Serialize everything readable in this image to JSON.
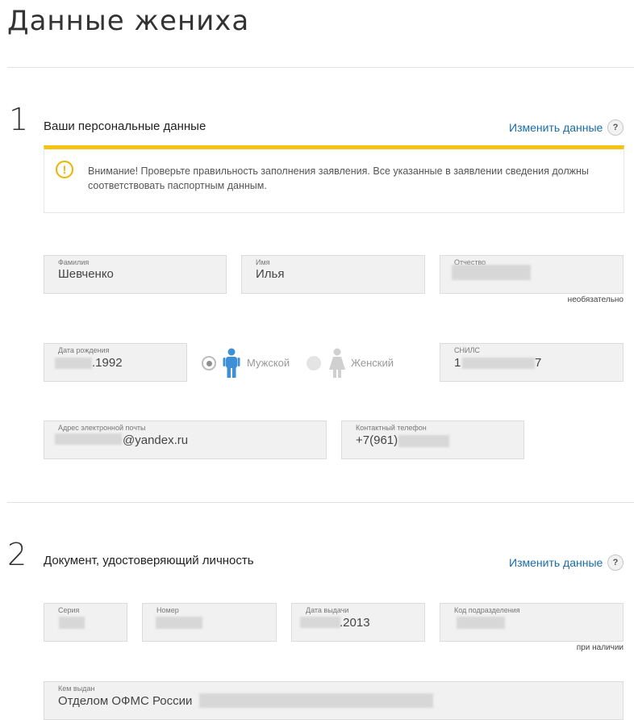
{
  "page": {
    "title": "Данные жениха"
  },
  "section1": {
    "number": "1",
    "title": "Ваши персональные данные",
    "edit_link": "Изменить данные",
    "help_label": "?",
    "warning": {
      "icon": "exclamation-circle-icon",
      "text": "Внимание! Проверьте правильность заполнения заявления. Все указанные в заявлении сведения должны соответствовать паспортным данным."
    },
    "fields": {
      "surname": {
        "label": "Фамилия",
        "value": "Шевченко"
      },
      "name": {
        "label": "Имя",
        "value": "Илья"
      },
      "patronymic": {
        "label": "Отчество",
        "value": "",
        "note": "необязательно"
      },
      "birthdate": {
        "label": "Дата рождения",
        "value": ".1992"
      },
      "snils": {
        "label": "СНИЛС",
        "value_start": "1",
        "value_end": "7"
      },
      "email": {
        "label": "Адрес электронной почты",
        "value": "@yandex.ru"
      },
      "phone": {
        "label": "Контактный телефон",
        "value": "+7(961)"
      }
    },
    "gender": {
      "male_label": "Мужской",
      "female_label": "Женский",
      "selected": "male"
    }
  },
  "section2": {
    "number": "2",
    "title": "Документ, удостоверяющий личность",
    "edit_link": "Изменить данные",
    "help_label": "?",
    "fields": {
      "series": {
        "label": "Серия",
        "value": ""
      },
      "number": {
        "label": "Номер",
        "value": ""
      },
      "issue_date": {
        "label": "Дата выдачи",
        "value": ".2013"
      },
      "division_code": {
        "label": "Код подразделения",
        "value": "",
        "note": "при наличии"
      },
      "issued_by": {
        "label": "Кем выдан",
        "value": "Отделом ОФМС России"
      }
    }
  },
  "colors": {
    "accent_link": "#1a6ba8",
    "warning_bar": "#f4c315",
    "male_icon": "#3d8fd6",
    "female_icon": "#d0d0d0"
  }
}
